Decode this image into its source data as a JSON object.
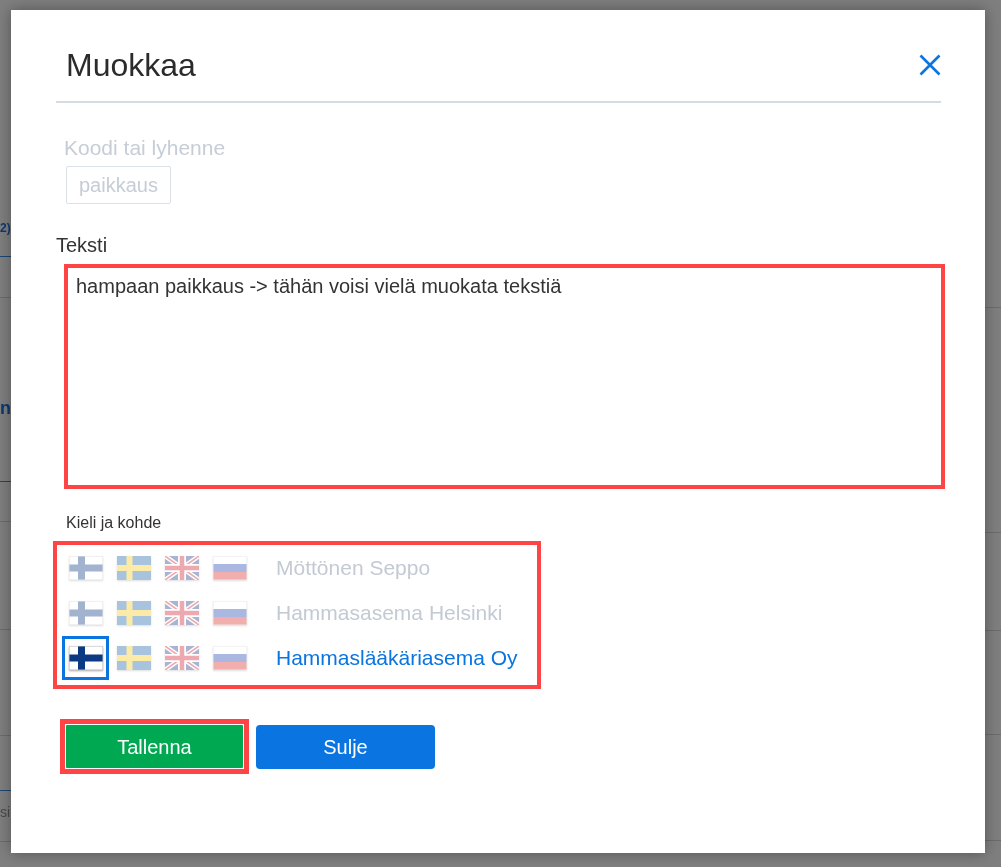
{
  "background_fragments": [
    {
      "text": "2)",
      "kind": "link"
    },
    {
      "text": "n",
      "kind": "link"
    },
    {
      "text": "si",
      "kind": "text"
    }
  ],
  "dialog": {
    "title": "Muokkaa",
    "code_field": {
      "label": "Koodi tai lyhenne",
      "value": "paikkaus",
      "disabled": true
    },
    "text_field": {
      "label": "Teksti",
      "value": "hampaan paikkaus -> tähän voisi vielä muokata tekstiä",
      "highlighted": true
    },
    "targets": {
      "label": "Kieli ja kohde",
      "highlighted": true,
      "items": [
        {
          "name": "Möttönen Seppo",
          "selected": false,
          "languages": [
            {
              "kind": "fi",
              "selected": false
            },
            {
              "kind": "sv",
              "selected": false
            },
            {
              "kind": "en",
              "selected": false
            },
            {
              "kind": "ru",
              "selected": false
            }
          ]
        },
        {
          "name": "Hammasasema Helsinki",
          "selected": false,
          "languages": [
            {
              "kind": "fi",
              "selected": false
            },
            {
              "kind": "sv",
              "selected": false
            },
            {
              "kind": "en",
              "selected": false
            },
            {
              "kind": "ru",
              "selected": false
            }
          ]
        },
        {
          "name": "Hammaslääkäriasema Oy",
          "selected": true,
          "languages": [
            {
              "kind": "fi",
              "selected": true
            },
            {
              "kind": "sv",
              "selected": false
            },
            {
              "kind": "en",
              "selected": false
            },
            {
              "kind": "ru",
              "selected": false
            }
          ]
        }
      ]
    },
    "buttons": [
      {
        "label": "Tallenna",
        "kind": "save",
        "highlighted": true
      },
      {
        "label": "Sulje",
        "kind": "close",
        "highlighted": false
      }
    ]
  }
}
